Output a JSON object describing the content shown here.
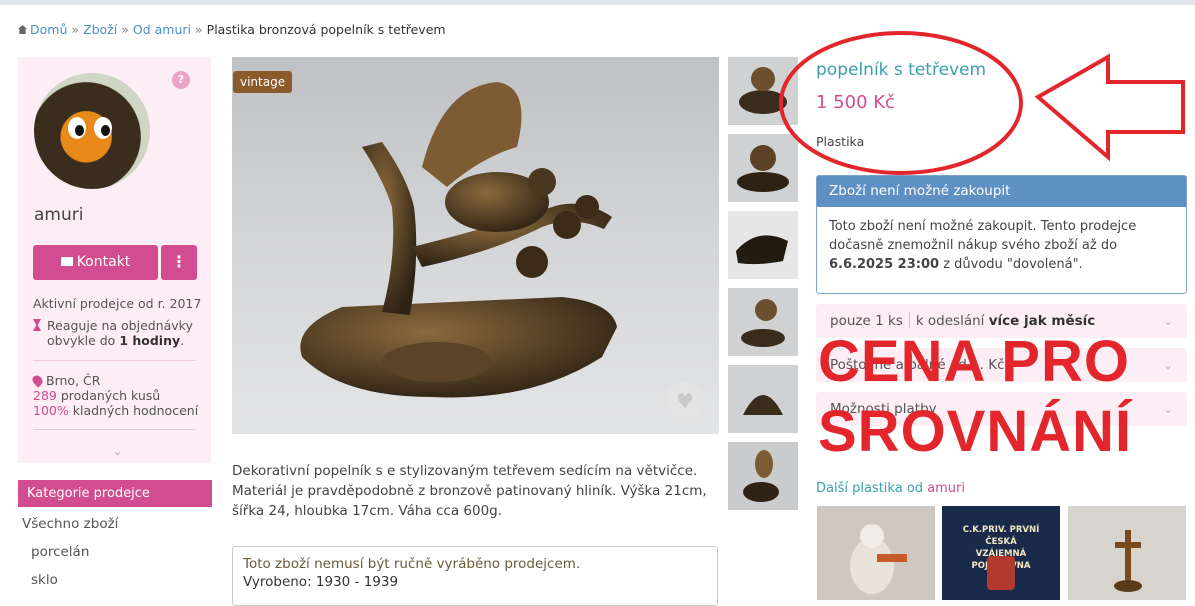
{
  "breadcrumb": {
    "items": [
      "Domů",
      "Zboží",
      "Od amuri"
    ],
    "current": "Plastika bronzová popelník s tetřevem"
  },
  "seller": {
    "name": "amuri",
    "contact_label": "Kontakt",
    "more_label": "⋮",
    "help_mark": "?",
    "active_since": "Aktivní prodejce od r. 2017",
    "response_prefix": "Reaguje na objednávky",
    "response_mid": "obvykle do",
    "response_time": "1 hodiny",
    "response_suffix": ".",
    "location": "Brno, ČR",
    "sold_count": "289",
    "sold_label": "prodaných kusů",
    "positive_pct": "100%",
    "positive_label": "kladných hodnocení",
    "expand": "⌄"
  },
  "categories": {
    "heading": "Kategorie prodejce",
    "items": [
      "Všechno zboží",
      "porcelán",
      "sklo"
    ]
  },
  "product": {
    "badge": "vintage",
    "heart": "♥",
    "title": "popelník s tetřevem",
    "price": "1 500 Kč",
    "material": "Plastika",
    "description": "Dekorativní popelník s e stylizovaným tetřevem sedícím na větvičce. Materiál je pravděpodobně z bronzově patinovaný hliník.  Výška 21cm, šířka 24, hloubka 17cm. Váha cca 600g.",
    "note_line1": "Toto zboží nemusí být ručně vyráběno prodejcem.",
    "note_line2": "Vyrobeno: 1930 - 1939"
  },
  "unavailable": {
    "heading": "Zboží není možné zakoupit",
    "text_before": "Toto zboží není možné zakoupit. Tento prodejce dočasně znemožnil nákup svého zboží až do",
    "date": "6.6.2025 23:00",
    "text_after": "z důvodu \"dovolená\"."
  },
  "rows": {
    "quantity": "pouze 1 ks",
    "shipping_prefix": "k odeslání",
    "shipping_time": "více jak měsíc",
    "postage": "Poštovné a balné od ... Kč",
    "payment": "Možnosti platby",
    "chevron": "⌄"
  },
  "more": {
    "prefix": "Další plastika od",
    "seller": "amuri",
    "thumb2_line1": "C.K.PRIV. PRVNÍ ČESKÁ",
    "thumb2_line2": "VZÁJEMNÁ POJIŠŤOVNA"
  },
  "annotation": {
    "line1": "CENA PRO",
    "line2": "SROVNÁNÍ",
    "color": "#e3262c"
  },
  "colors": {
    "accent_pink": "#d24d8f",
    "title_teal": "#3a9fb0",
    "panel_blue": "#5f90c4"
  }
}
